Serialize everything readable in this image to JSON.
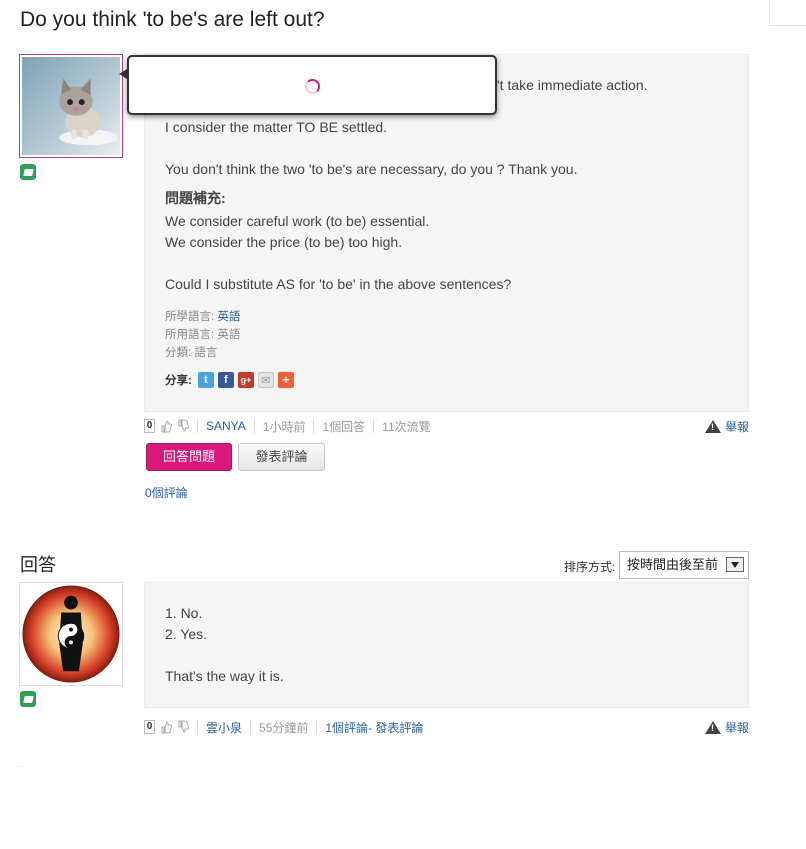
{
  "question": {
    "title": "Do you think 'to be's are left out?",
    "hidden_tail": "'t take immediate action.",
    "lines": [
      "I consider the matter TO BE settled.",
      "You don't think the two 'to be's are necessary, do you ? Thank you."
    ],
    "supplement_label": "問題補充:",
    "supplement_lines": [
      "We consider careful work (to be) essential.",
      "We consider the price (to be) too high.",
      "Could I substitute AS for 'to be' in the above sentences?"
    ],
    "meta": {
      "learn_label": "所學語言: ",
      "learn_value": "英語",
      "use_label": "所用語言: ",
      "use_value": "英語",
      "category_label": "分類: ",
      "category_value": "語言"
    },
    "share_label": "分享:",
    "share_icons": [
      "twitter-icon",
      "facebook-icon",
      "google-plus-icon",
      "email-icon",
      "plus-icon"
    ],
    "actions": {
      "votes": "0",
      "user": "SANYA",
      "time": "1小時前",
      "answers": "1個回答",
      "views": "11次流覽",
      "report": "舉報"
    },
    "answer_button": "回答問題",
    "comment_button": "發表評論",
    "comments_link": "0個評論"
  },
  "answers_section": {
    "title": "回答",
    "sort_label": "排序方式:",
    "sort_selected": "按時間由後至前"
  },
  "answer": {
    "lines": [
      "1. No.",
      "2. Yes.",
      "That's the way it is."
    ],
    "actions": {
      "votes": "0",
      "user": "雲小泉",
      "time": "55分鐘前",
      "comments": "1個評論",
      "add_comment": " - 發表評論",
      "report": "舉報"
    }
  },
  "colors": {
    "accent": "#d6197a",
    "link": "#2a5fa0",
    "badge": "#2f9e58"
  }
}
